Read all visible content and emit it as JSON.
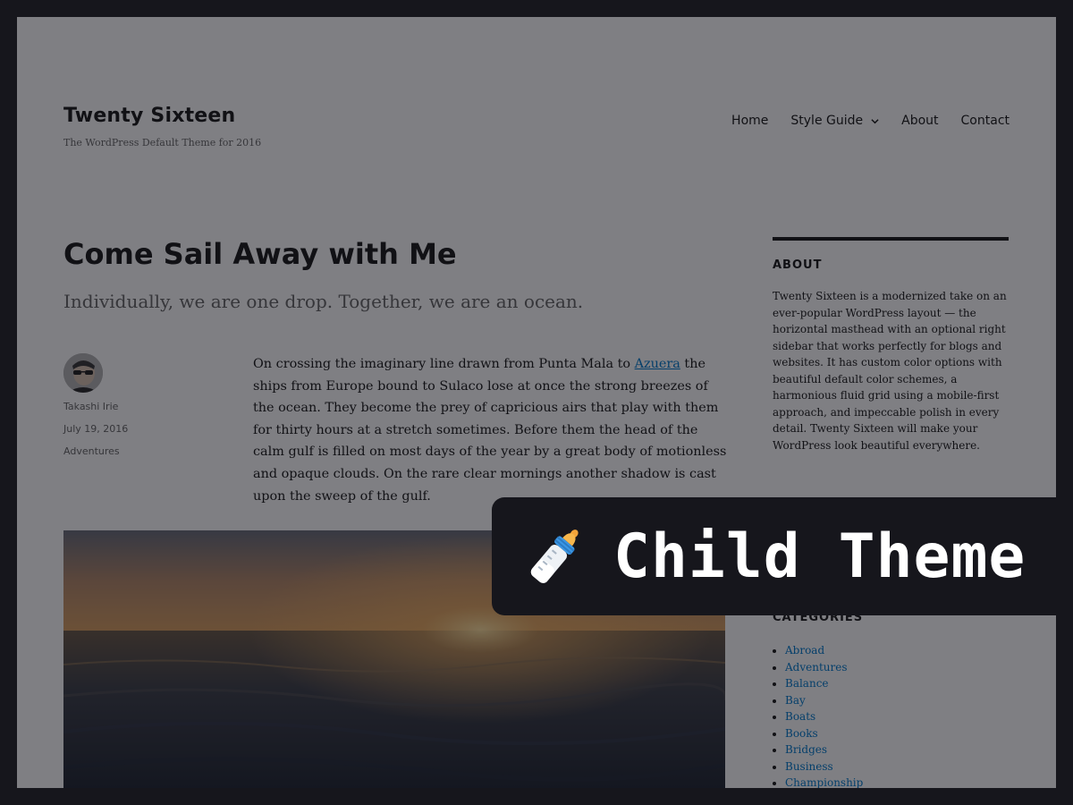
{
  "header": {
    "site_title": "Twenty Sixteen",
    "site_description": "The WordPress Default Theme for 2016"
  },
  "nav": {
    "items": [
      {
        "label": "Home"
      },
      {
        "label": "Style Guide",
        "has_submenu": true
      },
      {
        "label": "About"
      },
      {
        "label": "Contact"
      }
    ]
  },
  "post": {
    "title": "Come Sail Away with Me",
    "subtitle": "Individually, we are one drop. Together, we are an ocean.",
    "author": "Takashi Irie",
    "date": "July 19, 2016",
    "category": "Adventures",
    "body_before_link": "On crossing the imaginary line drawn from Punta Mala to ",
    "body_link": "Azuera",
    "body_after_link": " the ships from Europe bound to Sulaco lose at once the strong breezes of the ocean. They become the prey of capricious airs that play with them for thirty hours at a stretch sometimes. Before them the head of the calm gulf is filled on most days of the year by a great body of motionless and opaque clouds. On the rare clear mornings another shadow is cast upon the sweep of the gulf."
  },
  "sidebar": {
    "about_title": "ABOUT",
    "about_text": "Twenty Sixteen is a modernized take on an ever-popular WordPress layout — the horizontal masthead with an optional right sidebar that works perfectly for blogs and websites. It has custom color options with beautiful default color schemes, a harmonious fluid grid using a mobile-first approach, and impeccable polish in every detail. Twenty Sixteen will make your WordPress look beautiful everywhere.",
    "categories_title": "CATEGORIES",
    "categories": [
      "Abroad",
      "Adventures",
      "Balance",
      "Bay",
      "Boats",
      "Books",
      "Bridges",
      "Business",
      "Championship"
    ]
  },
  "badge": {
    "icon": "baby-bottle-icon",
    "label": "Child Theme"
  },
  "colors": {
    "link": "#007acc",
    "text": "#1a1a1a",
    "muted": "#686868",
    "backdrop": "#16161c"
  }
}
